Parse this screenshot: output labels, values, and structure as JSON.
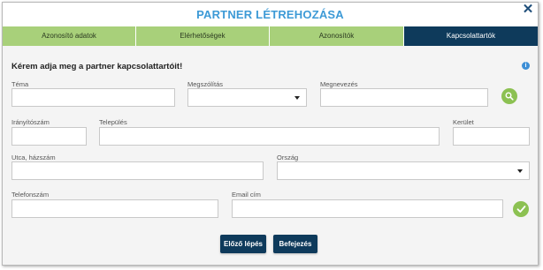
{
  "dialog": {
    "title": "PARTNER LÉTREHOZÁSA",
    "close_glyph": "✕"
  },
  "tabs": [
    {
      "label": "Azonosító adatok",
      "active": false
    },
    {
      "label": "Elérhetőségek",
      "active": false
    },
    {
      "label": "Azonosítók",
      "active": false
    },
    {
      "label": "Kapcsolattartók",
      "active": true
    }
  ],
  "form": {
    "heading": "Kérem adja meg a partner kapcsolattartóit!",
    "info_glyph": "i",
    "fields": {
      "tema": {
        "label": "Téma",
        "value": ""
      },
      "megszolitas": {
        "label": "Megszólítás",
        "value": ""
      },
      "megnevezes": {
        "label": "Megnevezés",
        "value": ""
      },
      "iranyitoszam": {
        "label": "Irányítószám",
        "value": ""
      },
      "telepules": {
        "label": "Település",
        "value": ""
      },
      "kerulet": {
        "label": "Kerület",
        "value": ""
      },
      "utca": {
        "label": "Utca, házszám",
        "value": ""
      },
      "orszag": {
        "label": "Ország",
        "value": ""
      },
      "telefonszam": {
        "label": "Telefonszám",
        "value": ""
      },
      "email": {
        "label": "Email cím",
        "value": ""
      }
    }
  },
  "icons": {
    "search": "search-icon",
    "confirm": "check-icon",
    "info": "info-icon",
    "close": "close-icon"
  },
  "colors": {
    "title": "#3d9ad6",
    "tab_inactive": "#a8d07a",
    "tab_active": "#0e3a5b",
    "action_green": "#8cc152",
    "button": "#0e3a5b"
  },
  "buttons": {
    "previous": "Előző lépés",
    "finish": "Befejezés"
  }
}
